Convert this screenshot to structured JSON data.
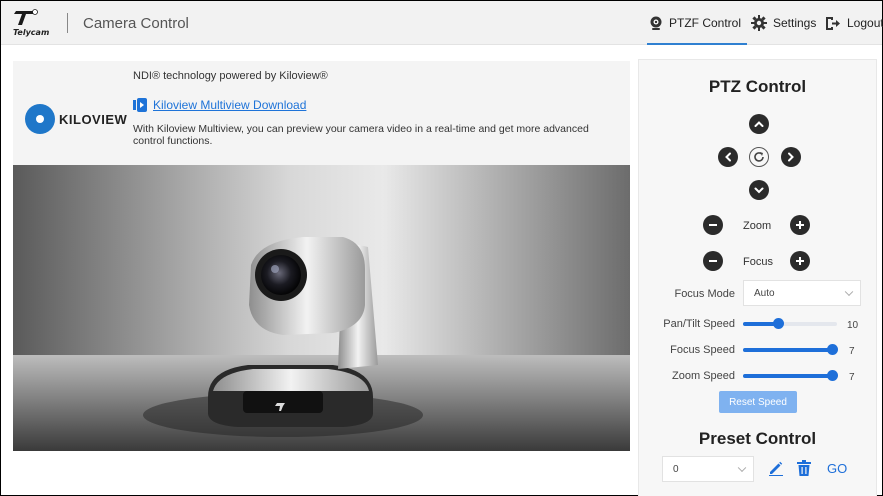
{
  "header": {
    "brand": "Telycam",
    "title": "Camera Control",
    "nav": [
      {
        "label": "PTZF Control",
        "icon": "camera-icon",
        "active": true
      },
      {
        "label": "Settings",
        "icon": "gear-icon"
      },
      {
        "label": "Logout",
        "icon": "logout-icon"
      }
    ]
  },
  "promo": {
    "tagline": "NDI® technology powered by Kiloview®",
    "logo_text": "KILOVIEW",
    "link_label": "Kiloview Multiview Download",
    "description": "With Kiloview Multiview, you can preview your camera video in a real-time and get more advanced control functions."
  },
  "camera_image": {
    "badge_text": "Telycam"
  },
  "ptz": {
    "title": "PTZ Control",
    "zoom_label": "Zoom",
    "focus_label": "Focus",
    "focus_mode": {
      "label": "Focus Mode",
      "value": "Auto"
    },
    "speeds": [
      {
        "label": "Pan/Tilt Speed",
        "value": "10",
        "fraction": 0.39
      },
      {
        "label": "Focus Speed",
        "value": "7",
        "fraction": 1.0
      },
      {
        "label": "Zoom Speed",
        "value": "7",
        "fraction": 1.0
      }
    ],
    "reset_label": "Reset Speed"
  },
  "preset": {
    "title": "Preset Control",
    "value": "0",
    "go_label": "GO"
  },
  "colors": {
    "accent": "#1e6fd9",
    "nav_underline": "#2f80d1",
    "reset_button": "#7fb2f0"
  }
}
